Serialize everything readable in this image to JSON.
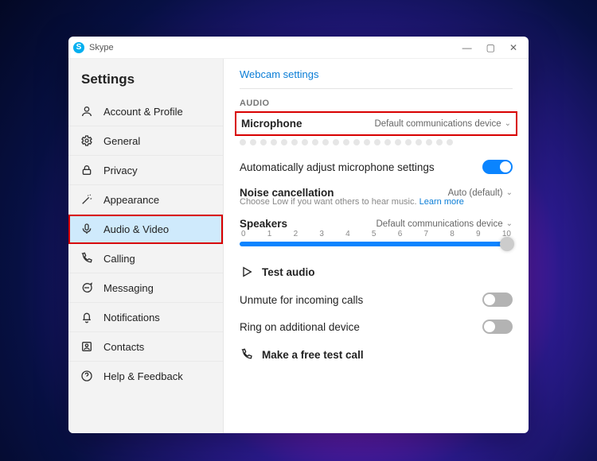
{
  "window": {
    "app_name": "Skype"
  },
  "sidebar": {
    "title": "Settings",
    "items": [
      {
        "label": "Account & Profile",
        "icon": "account-icon"
      },
      {
        "label": "General",
        "icon": "gear-icon"
      },
      {
        "label": "Privacy",
        "icon": "lock-icon"
      },
      {
        "label": "Appearance",
        "icon": "wand-icon"
      },
      {
        "label": "Audio & Video",
        "icon": "microphone-icon",
        "active": true
      },
      {
        "label": "Calling",
        "icon": "phone-icon"
      },
      {
        "label": "Messaging",
        "icon": "chat-icon"
      },
      {
        "label": "Notifications",
        "icon": "bell-icon"
      },
      {
        "label": "Contacts",
        "icon": "contacts-icon"
      },
      {
        "label": "Help & Feedback",
        "icon": "help-icon"
      }
    ]
  },
  "content": {
    "webcam_link": "Webcam settings",
    "audio_label": "AUDIO",
    "microphone": {
      "label": "Microphone",
      "value": "Default communications device"
    },
    "auto_adjust": {
      "label": "Automatically adjust microphone settings",
      "on": true
    },
    "noise": {
      "label": "Noise cancellation",
      "value": "Auto (default)",
      "sub": "Choose Low if you want others to hear music.",
      "learn": "Learn more"
    },
    "speakers": {
      "label": "Speakers",
      "value": "Default communications device",
      "ticks": [
        "0",
        "1",
        "2",
        "3",
        "4",
        "5",
        "6",
        "7",
        "8",
        "9",
        "10"
      ],
      "position": 10
    },
    "test_audio": "Test audio",
    "unmute": {
      "label": "Unmute for incoming calls",
      "on": false
    },
    "ring_additional": {
      "label": "Ring on additional device",
      "on": false
    },
    "free_call": "Make a free test call"
  }
}
